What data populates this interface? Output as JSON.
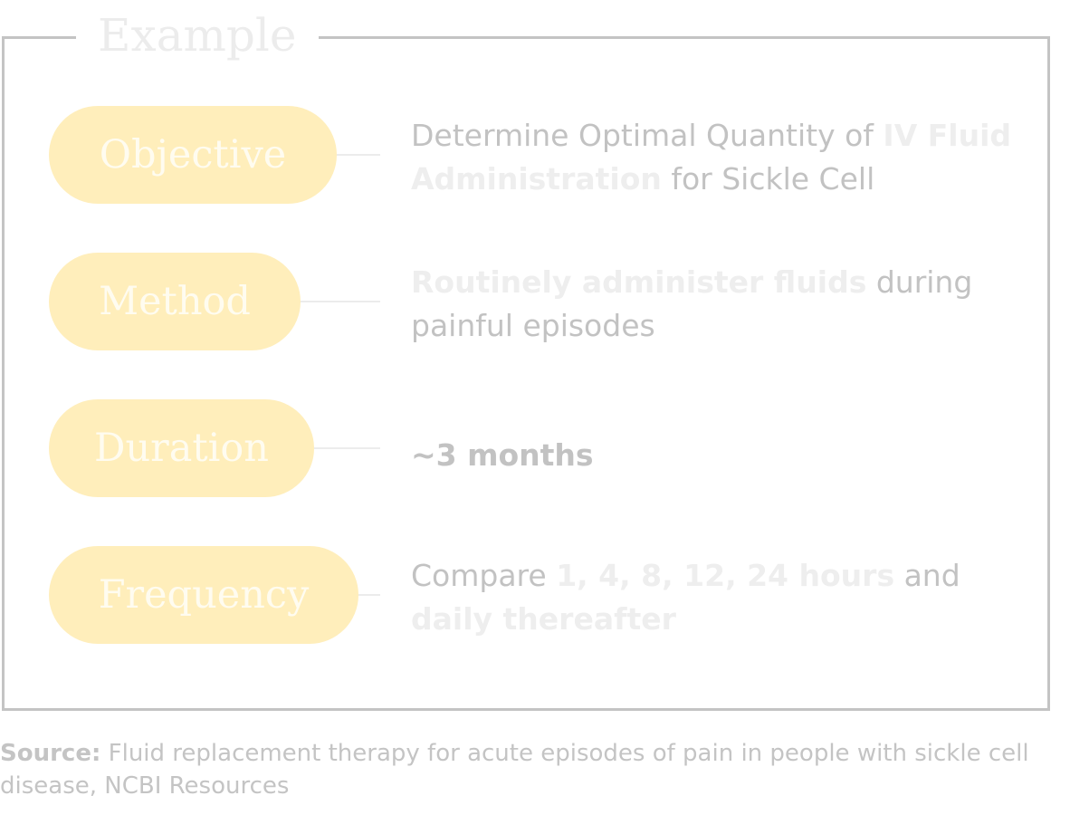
{
  "title": "Example",
  "rows": [
    {
      "label": "Objective",
      "parts": [
        {
          "text": "Determine Optimal Quantity of ",
          "style": "normal"
        },
        {
          "text": "IV Fluid Administration",
          "style": "light"
        },
        {
          "text": " for Sickle Cell",
          "style": "normal"
        }
      ]
    },
    {
      "label": "Method",
      "parts": [
        {
          "text": "Routinely administer fluids",
          "style": "light"
        },
        {
          "text": " during painful episodes",
          "style": "normal"
        }
      ]
    },
    {
      "label": "Duration",
      "parts": [
        {
          "text": "~3 months",
          "style": "strong"
        }
      ]
    },
    {
      "label": "Frequency",
      "parts": [
        {
          "text": "Compare ",
          "style": "normal"
        },
        {
          "text": "1, 4, 8, 12, 24 hours",
          "style": "light"
        },
        {
          "text": " and ",
          "style": "normal"
        },
        {
          "text": "daily thereafter",
          "style": "light"
        }
      ]
    }
  ],
  "source": {
    "label": "Source:",
    "text": " Fluid replacement therapy for acute episodes of pain in people with sickle cell disease, NCBI Resources"
  },
  "colors": {
    "pill_fill": "#ffeebb",
    "frame_border": "#c4c4c4",
    "text_gray": "#c2c2c2",
    "text_light": "#eeeeee"
  }
}
